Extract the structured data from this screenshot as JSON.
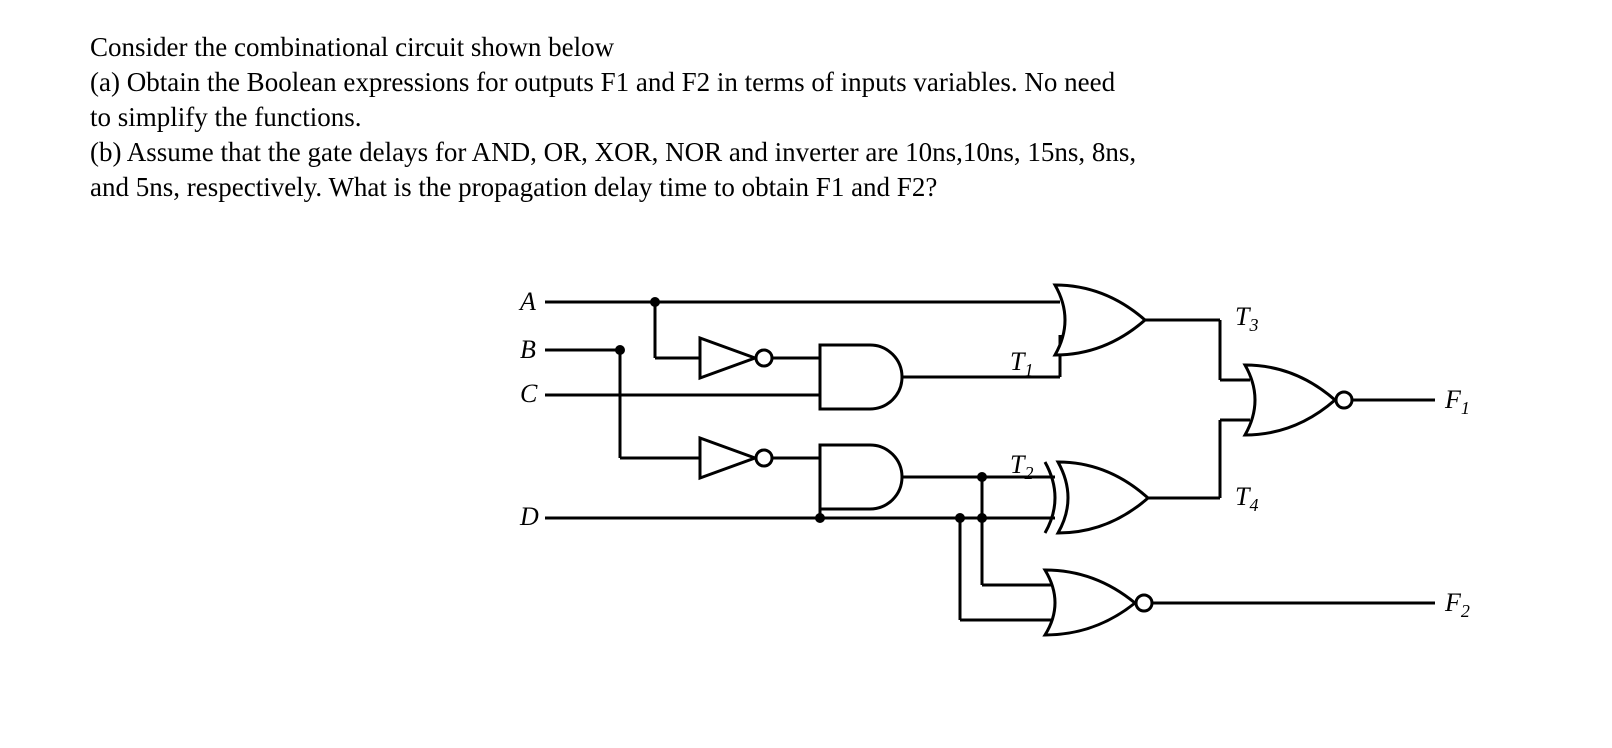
{
  "problem": {
    "intro": "Consider the combinational circuit shown below",
    "part_a": " (a) Obtain the Boolean expressions for outputs F1 and F2 in terms of inputs variables. No need to simplify the functions.",
    "part_b": "(b) Assume that the gate delays for AND, OR, XOR, NOR and inverter are 10ns,10ns, 15ns, 8ns, and 5ns, respectively. What is the propagation delay time to obtain F1 and F2?"
  },
  "circuit": {
    "inputs": {
      "A": "A",
      "B": "B",
      "C": "C",
      "D": "D"
    },
    "nodes": {
      "T1": "T",
      "T1sub": "1",
      "T2": "T",
      "T2sub": "2",
      "T3": "T",
      "T3sub": "3",
      "T4": "T",
      "T4sub": "4"
    },
    "outputs": {
      "F1": "F",
      "F1sub": "1",
      "F2": "F",
      "F2sub": "2"
    }
  },
  "chart_data": {
    "type": "circuit-diagram",
    "inputs": [
      "A",
      "B",
      "C",
      "D"
    ],
    "gates": [
      {
        "id": "INV1",
        "type": "NOT",
        "inputs": [
          "A"
        ],
        "output": "A'"
      },
      {
        "id": "INV2",
        "type": "NOT",
        "inputs": [
          "B"
        ],
        "output": "B'"
      },
      {
        "id": "AND1",
        "type": "AND",
        "inputs": [
          "A'",
          "C"
        ],
        "output": "T1"
      },
      {
        "id": "AND2",
        "type": "AND",
        "inputs": [
          "B'",
          "D"
        ],
        "output": "T2"
      },
      {
        "id": "OR1",
        "type": "OR",
        "inputs": [
          "A",
          "T1"
        ],
        "output": "T3"
      },
      {
        "id": "XOR1",
        "type": "XOR",
        "inputs": [
          "T2",
          "D"
        ],
        "output": "T4"
      },
      {
        "id": "NOR1",
        "type": "NOR",
        "inputs": [
          "T3",
          "T4"
        ],
        "output": "F1"
      },
      {
        "id": "NOR2",
        "type": "NOR",
        "inputs": [
          "T2",
          "D"
        ],
        "output": "F2"
      }
    ],
    "outputs": [
      "F1",
      "F2"
    ],
    "gate_delays_ns": {
      "AND": 10,
      "OR": 10,
      "XOR": 15,
      "NOR": 8,
      "NOT": 5
    }
  }
}
